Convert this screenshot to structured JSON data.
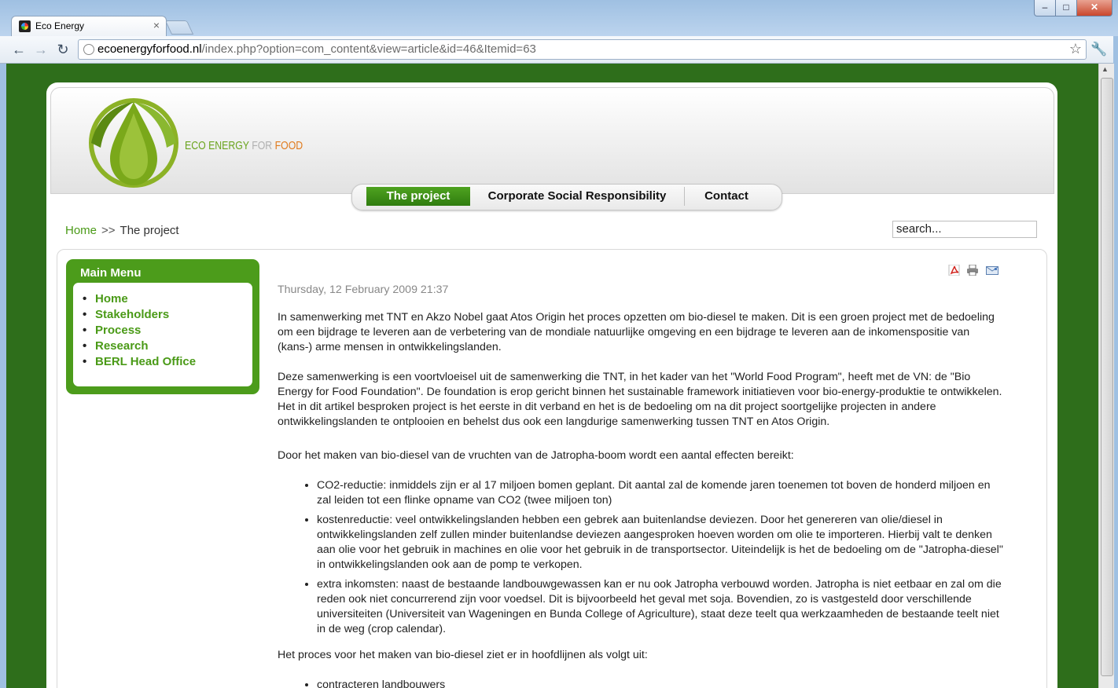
{
  "browser": {
    "tab_title": "Eco Energy",
    "tab_close": "×",
    "url_host": "ecoenergyforfood.nl",
    "url_path": "/index.php?option=com_content&view=article&id=46&Itemid=63",
    "icons": {
      "back": "arrow-left-icon",
      "forward": "arrow-right-icon",
      "reload": "reload-icon",
      "star": "star-icon",
      "wrench": "wrench-icon"
    }
  },
  "site": {
    "logo": {
      "part1": "ECO ENERGY ",
      "part2": "FOR ",
      "part3": "FOOD"
    },
    "colors": {
      "green": "#4c9c1b",
      "dark_green_bg": "#2e6e1b",
      "orange": "#e07a1c"
    },
    "nav": [
      {
        "label": "The project"
      },
      {
        "label": "Corporate Social Responsibility"
      },
      {
        "label": "Contact"
      }
    ],
    "breadcrumb": {
      "home": "Home",
      "sep": ">>",
      "current": "The project"
    },
    "search_value": "search..."
  },
  "main_menu": {
    "title": "Main Menu",
    "items": [
      "Home",
      "Stakeholders",
      "Process",
      "Research",
      "BERL Head Office"
    ]
  },
  "article": {
    "date": "Thursday, 12 February 2009 21:37",
    "p1": "In samenwerking met TNT en Akzo Nobel gaat Atos Origin het proces opzetten om bio-diesel te maken. Dit is een groen project met de bedoeling om een bijdrage te leveren aan de verbetering van de mondiale natuurlijke omgeving en een bijdrage te leveren aan de inkomenspositie van (kans-) arme mensen in ontwikkelingslanden.",
    "p2": "Deze samenwerking is een voortvloeisel uit de samenwerking die TNT, in het kader van het \"World Food Program\", heeft met de VN: de \"Bio Energy for Food Foundation\". De foundation is erop gericht binnen het sustainable framework initiatieven voor bio-energy-produktie te ontwikkelen. Het in dit artikel besproken project is het eerste in dit verband en het is de bedoeling om na dit project soortgelijke projecten in andere ontwikkelingslanden te ontplooien en behelst dus ook een langdurige samenwerking tussen TNT en Atos Origin.",
    "p3": "Door het maken van bio-diesel van de vruchten van de Jatropha-boom wordt een aantal effecten bereikt:",
    "effects": [
      "CO2-reductie: inmiddels zijn er al 17 miljoen bomen geplant. Dit aantal zal de komende jaren toenemen tot boven de honderd miljoen en zal leiden tot een flinke opname van CO2 (twee miljoen ton)",
      "kostenreductie: veel ontwikkelingslanden hebben een gebrek aan buitenlandse deviezen. Door het genereren van olie/diesel in ontwikkelingslanden zelf zullen minder buitenlandse deviezen aangesproken hoeven worden om olie te importeren. Hierbij valt te denken aan olie voor het gebruik in machines en olie voor het gebruik in de transportsector. Uiteindelijk is het de bedoeling om de \"Jatropha-diesel\" in ontwikkelingslanden ook aan de pomp te verkopen.",
      "extra inkomsten: naast de bestaande landbouwgewassen kan er nu ook Jatropha verbouwd worden. Jatropha is niet eetbaar en zal om die reden ook niet concurrerend zijn voor voedsel. Dit is bijvoorbeeld het geval met soja. Bovendien, zo is vastgesteld door verschillende universiteiten (Universiteit van Wageningen en Bunda College of Agriculture), staat deze teelt qua werkzaamheden de bestaande teelt niet in de weg (crop calendar)."
    ],
    "p4": "Het proces voor het maken van bio-diesel ziet er in hoofdlijnen als volgt uit:",
    "steps": [
      "contracteren landbouwers"
    ],
    "icons": {
      "pdf": "pdf-icon",
      "print": "print-icon",
      "email": "email-icon"
    }
  }
}
